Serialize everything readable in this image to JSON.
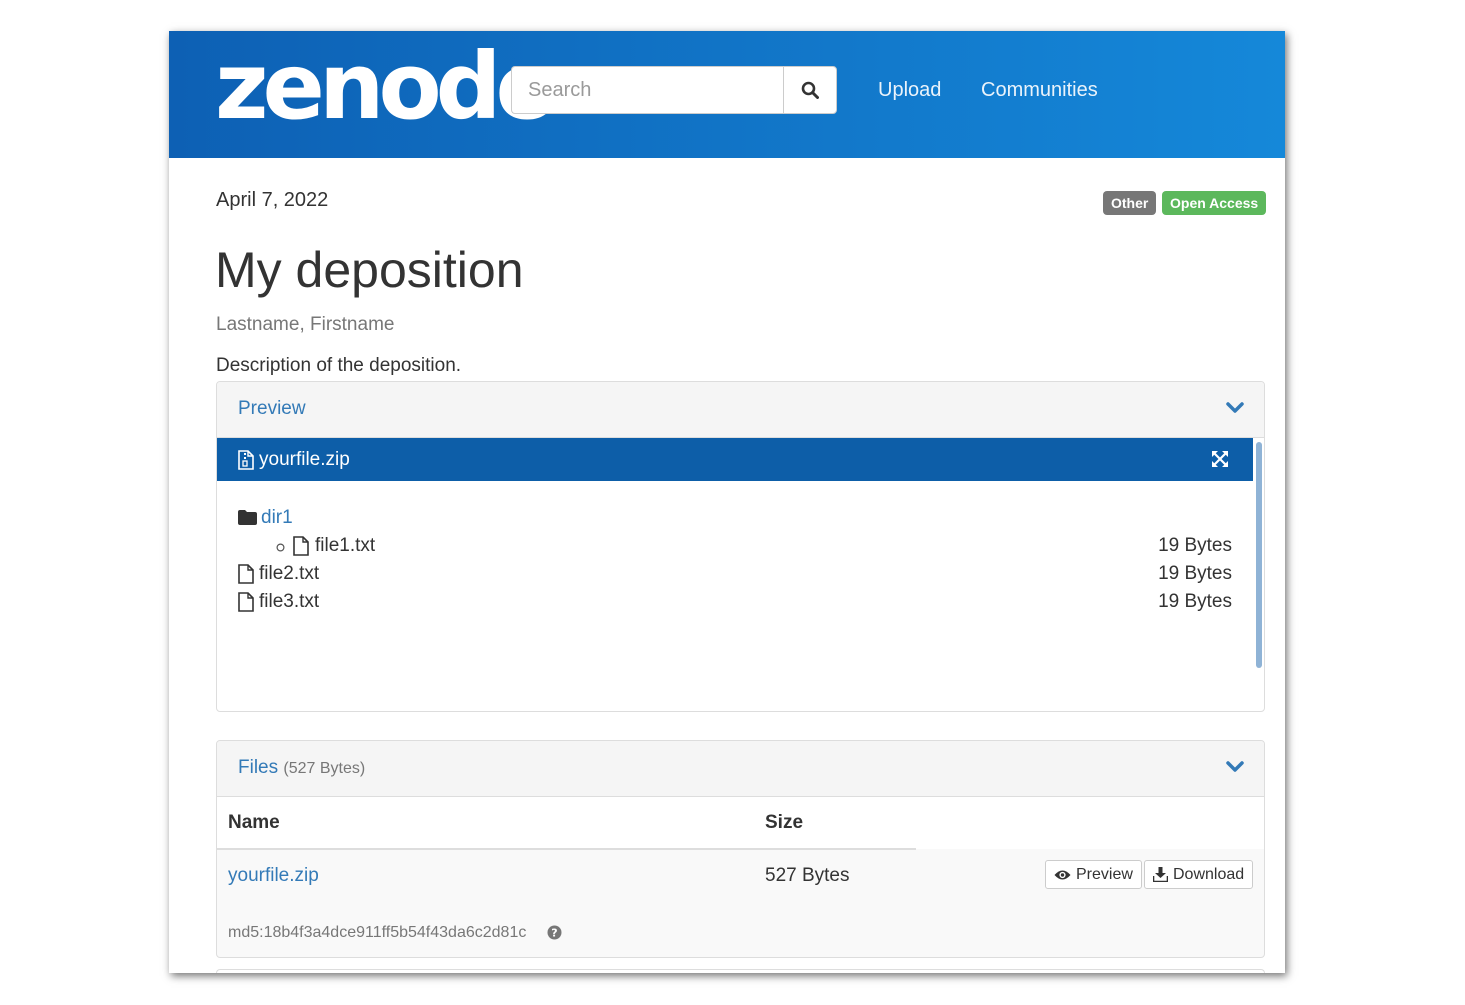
{
  "header": {
    "logo_text": "zenodo",
    "search": {
      "placeholder": "Search",
      "value": ""
    },
    "nav": [
      {
        "label": "Upload"
      },
      {
        "label": "Communities"
      }
    ]
  },
  "record": {
    "date": "April 7, 2022",
    "badges": [
      {
        "label": "Other",
        "color": "#777777"
      },
      {
        "label": "Open Access",
        "color": "#5cb85c"
      }
    ],
    "title": "My deposition",
    "creators": "Lastname, Firstname",
    "description": "Description of the deposition."
  },
  "preview_panel": {
    "title": "Preview",
    "file": "yourfile.zip",
    "tree": [
      {
        "name": "dir1",
        "kind": "folder",
        "size": ""
      },
      {
        "name": "file1.txt",
        "kind": "file",
        "size": "19 Bytes"
      },
      {
        "name": "file2.txt",
        "kind": "file",
        "size": "19 Bytes"
      },
      {
        "name": "file3.txt",
        "kind": "file",
        "size": "19 Bytes"
      }
    ]
  },
  "files_panel": {
    "title": "Files",
    "total_size": "(527 Bytes)",
    "columns": [
      "Name",
      "Size"
    ],
    "rows": [
      {
        "name": "yourfile.zip",
        "size": "527 Bytes",
        "checksum": "md5:18b4f3a4dce911ff5b54f43da6c2d81c",
        "preview_label": "Preview",
        "download_label": "Download"
      }
    ]
  },
  "icons": [
    "search-icon",
    "chevron-down-icon",
    "zip-file-icon",
    "expand-icon",
    "folder-icon",
    "file-icon",
    "eye-icon",
    "download-icon",
    "question-circle-icon"
  ],
  "colors": {
    "brand_dark": "#0d60b4",
    "brand_light": "#1588d9",
    "link": "#337ab7"
  }
}
